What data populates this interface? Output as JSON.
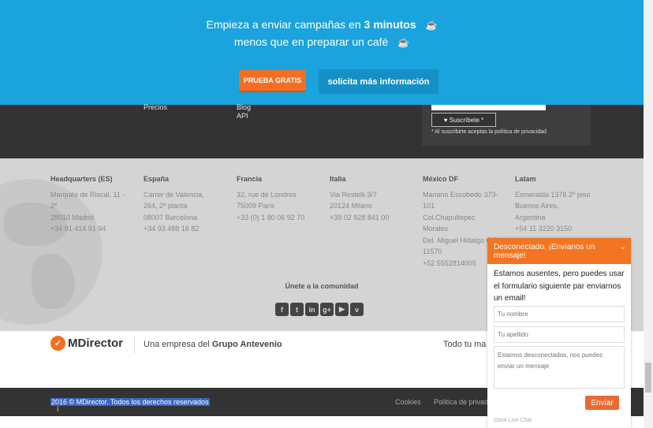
{
  "banner": {
    "line1_prefix": "Empieza a enviar campañas en ",
    "line1_bold": "3 minutos",
    "line2": "menos que en preparar un café",
    "cup_icon": "coffee-cup-icon",
    "trial_button": "PRUEBA GRATIS",
    "info_button": "solicita más información",
    "bg_color": "#1aa3dd",
    "accent_color": "#f36e21"
  },
  "footer_menu": {
    "links": [
      "Precios",
      "Blog",
      "API"
    ],
    "subscribe_button": "Suscríbete *",
    "subscribe_note": "* Al suscribirte aceptas la política de privacidad"
  },
  "offices": [
    {
      "name": "Headquarters (ES)",
      "lines": [
        "Marqués de Riscal, 11 -",
        "2º",
        "28010 Madrid",
        "+34 91 414 91 94"
      ]
    },
    {
      "name": "España",
      "lines": [
        "Carrer de Valencia,",
        "264, 2ª planta",
        "08007 Barcelona",
        "+34 93 488 16 82"
      ]
    },
    {
      "name": "Francia",
      "lines": [
        "32, rue de Londres",
        "75009 Paris",
        "+33 (0) 1 80 06 92 70"
      ]
    },
    {
      "name": "Italia",
      "lines": [
        "Via Restelli 3/7",
        "20124 Milano",
        "+39 02 928 841 00"
      ]
    },
    {
      "name": "México DF",
      "lines": [
        "Mariano Escobedo 373-",
        "101",
        "Col.Chapultepec",
        "Morales",
        "Del. Miguel Hidalgo C.P.",
        "11570",
        "+52 5552814005"
      ]
    },
    {
      "name": "Latam",
      "lines": [
        "Esmeralda 1376 2º piso",
        "Buenos Aires,",
        "Argentina",
        "+54 11 3220 3150"
      ]
    }
  ],
  "community": {
    "title": "Únete a la comunidad",
    "social": [
      {
        "icon": "facebook-icon",
        "glyph": "f"
      },
      {
        "icon": "twitter-icon",
        "glyph": "t"
      },
      {
        "icon": "linkedin-icon",
        "glyph": "in"
      },
      {
        "icon": "google-plus-icon",
        "glyph": "g+"
      },
      {
        "icon": "youtube-icon",
        "glyph": "▶"
      },
      {
        "icon": "vimeo-icon",
        "glyph": "v"
      }
    ]
  },
  "brand": {
    "logo_text": "MDirector",
    "tagline_prefix": "Una empresa del ",
    "tagline_bold": "Grupo Antevenio",
    "tagline_right": "Todo tu ma"
  },
  "bottom_bar": {
    "copyright": "2016 © MDirector. Todos los derechos reservados",
    "links": [
      "Cookies",
      "Política de privad"
    ]
  },
  "chat": {
    "header": "Desconectado. ¡Envíanos un mensaje!",
    "message": "Estamos ausentes, pero puedes usar el formulario siguiente par enviarnos un email!",
    "name_placeholder": "Tu nombre",
    "surname_placeholder": "Tu apellido",
    "message_placeholder": "Estamos desconectados, nos puedes enviar un mensaje",
    "send_button": "Enviar",
    "footer": "Olark Live Chat",
    "header_color": "#f47521"
  }
}
